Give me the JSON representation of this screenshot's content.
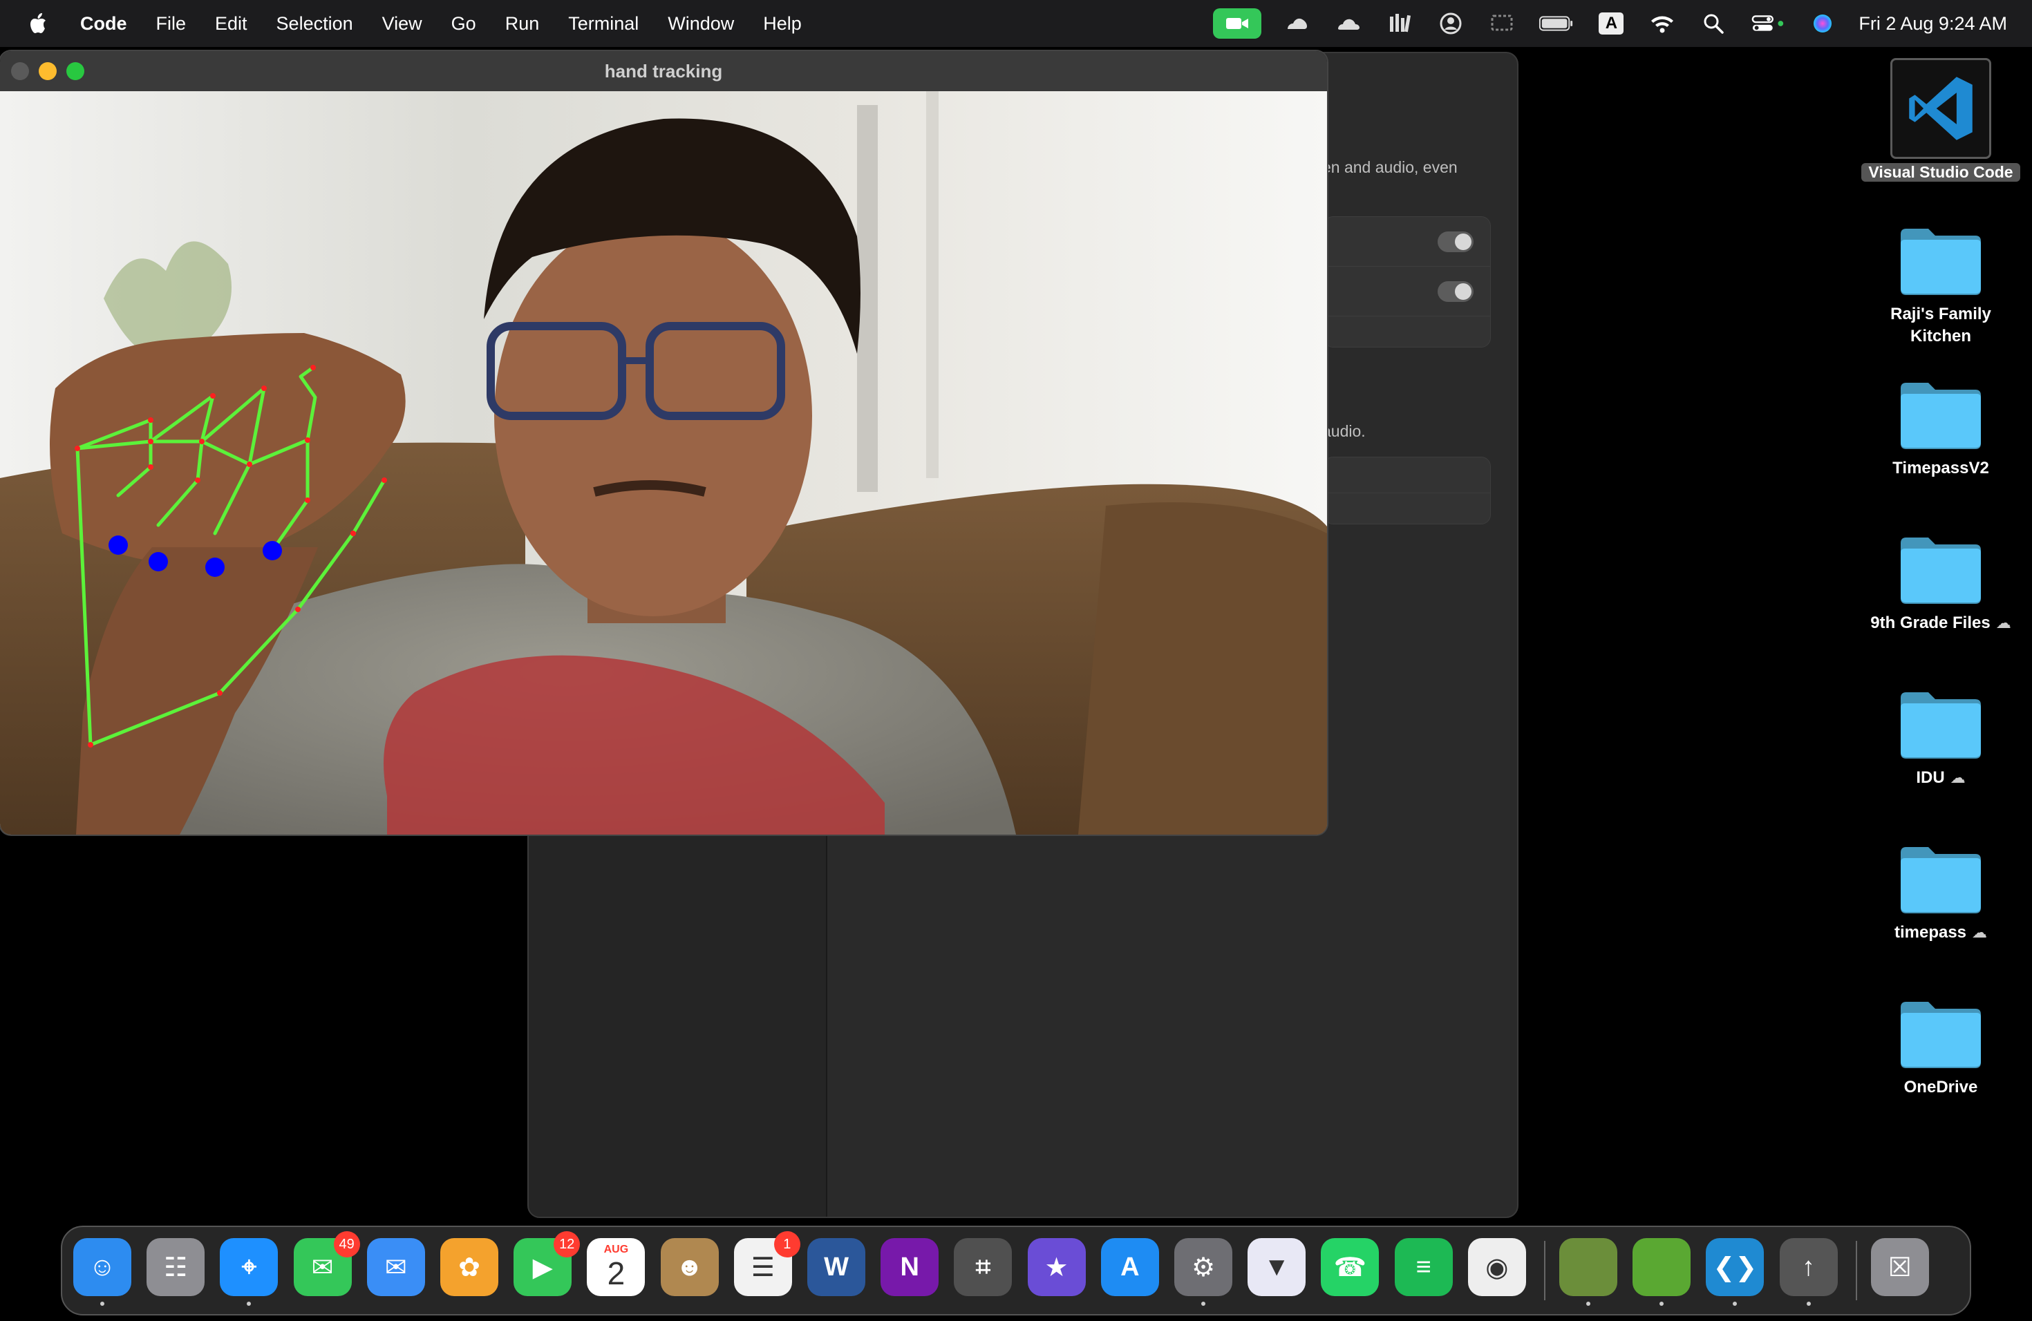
{
  "menubar": {
    "app_name": "Code",
    "items": [
      "File",
      "Edit",
      "Selection",
      "View",
      "Go",
      "Run",
      "Terminal",
      "Window",
      "Help"
    ],
    "keyboard_input": "A",
    "clock": "Fri 2 Aug  9:24 AM",
    "status_icons": [
      "facetime-camera-icon",
      "creative-cloud-icon",
      "onedrive-cloud-icon",
      "library-icon",
      "user-account-icon",
      "screen-mirroring-icon",
      "battery-icon",
      "input-source-icon",
      "wifi-icon",
      "spotlight-search-icon",
      "control-center-icon",
      "siri-icon"
    ]
  },
  "settings_window": {
    "text_1": "en and audio, even",
    "text_2": "audio."
  },
  "hand_window": {
    "title": "hand tracking",
    "colors": {
      "skeleton": "#5cf23a",
      "joint": "#ff2020",
      "fingertip": "#0000ff"
    }
  },
  "desktop": {
    "items": [
      {
        "label": "Visual Studio Code",
        "type": "app"
      },
      {
        "label": "Raji's Family\nKitchen",
        "type": "folder"
      },
      {
        "label": "TimepassV2",
        "type": "folder"
      },
      {
        "label": "9th Grade Files",
        "type": "folder",
        "cloud": "☁"
      },
      {
        "label": "IDU",
        "type": "folder",
        "cloud": "☁"
      },
      {
        "label": "timepass",
        "type": "folder",
        "cloud": "☁"
      },
      {
        "label": "OneDrive",
        "type": "folder"
      }
    ],
    "folder_color": "#5ac8fa"
  },
  "dock": {
    "apps": [
      {
        "name": "Finder",
        "icon": "finder-icon",
        "glyph": "☺",
        "color": "#2d8cf0",
        "running": true
      },
      {
        "name": "Launchpad",
        "icon": "launchpad-icon",
        "glyph": "☷",
        "color": "#8e8e93"
      },
      {
        "name": "Safari",
        "icon": "safari-icon",
        "glyph": "⌖",
        "color": "#1e90ff",
        "running": true
      },
      {
        "name": "Messages",
        "icon": "messages-icon",
        "glyph": "✉",
        "color": "#34c759",
        "badge": "49"
      },
      {
        "name": "Mail",
        "icon": "mail-icon",
        "glyph": "✉",
        "color": "#3a8ef6"
      },
      {
        "name": "Photos",
        "icon": "photos-icon",
        "glyph": "✿",
        "color": "#f4a22d"
      },
      {
        "name": "FaceTime",
        "icon": "facetime-icon",
        "glyph": "▶",
        "color": "#34c759",
        "badge": "12"
      },
      {
        "name": "Calendar",
        "icon": "calendar-icon",
        "glyph": "2",
        "color": "#ffffff",
        "month": "AUG"
      },
      {
        "name": "Contacts",
        "icon": "contacts-icon",
        "glyph": "☻",
        "color": "#b08850"
      },
      {
        "name": "Reminders",
        "icon": "reminders-icon",
        "glyph": "☰",
        "color": "#f2f2f2",
        "badge": "1"
      },
      {
        "name": "Microsoft Word",
        "icon": "word-icon",
        "glyph": "W",
        "color": "#2b579a"
      },
      {
        "name": "OneNote",
        "icon": "onenote-icon",
        "glyph": "N",
        "color": "#7719aa"
      },
      {
        "name": "Calculator",
        "icon": "calculator-icon",
        "glyph": "⌗",
        "color": "#505050"
      },
      {
        "name": "iMovie",
        "icon": "imovie-icon",
        "glyph": "★",
        "color": "#6a4dd6"
      },
      {
        "name": "App Store",
        "icon": "app-store-icon",
        "glyph": "A",
        "color": "#1e8cf3"
      },
      {
        "name": "System Settings",
        "icon": "system-settings-icon",
        "glyph": "⚙",
        "color": "#6e6e73",
        "running": true
      },
      {
        "name": "Proton VPN",
        "icon": "vpn-icon",
        "glyph": "▼",
        "color": "#e8e8f5"
      },
      {
        "name": "WhatsApp",
        "icon": "whatsapp-icon",
        "glyph": "☎",
        "color": "#25d366"
      },
      {
        "name": "Spotify",
        "icon": "spotify-icon",
        "glyph": "≡",
        "color": "#1db954"
      },
      {
        "name": "Google Chrome",
        "icon": "chrome-icon",
        "glyph": "◉",
        "color": "#eeeeee"
      },
      {
        "name": "Minecraft Launcher",
        "icon": "minecraft-icon",
        "glyph": "",
        "color": "#6b8e3a",
        "running": true
      },
      {
        "name": "Minecraft",
        "icon": "minecraft-grass-icon",
        "glyph": "",
        "color": "#5aa832",
        "running": true
      },
      {
        "name": "Visual Studio Code",
        "icon": "vscode-icon",
        "glyph": "❮❯",
        "color": "#1f8ad2",
        "running": true
      },
      {
        "name": "Rocket Typist",
        "icon": "rocket-icon",
        "glyph": "↑",
        "color": "#555555",
        "running": true
      },
      {
        "name": "Trash",
        "icon": "trash-icon",
        "glyph": "☒",
        "color": "#8e8e93"
      }
    ]
  }
}
